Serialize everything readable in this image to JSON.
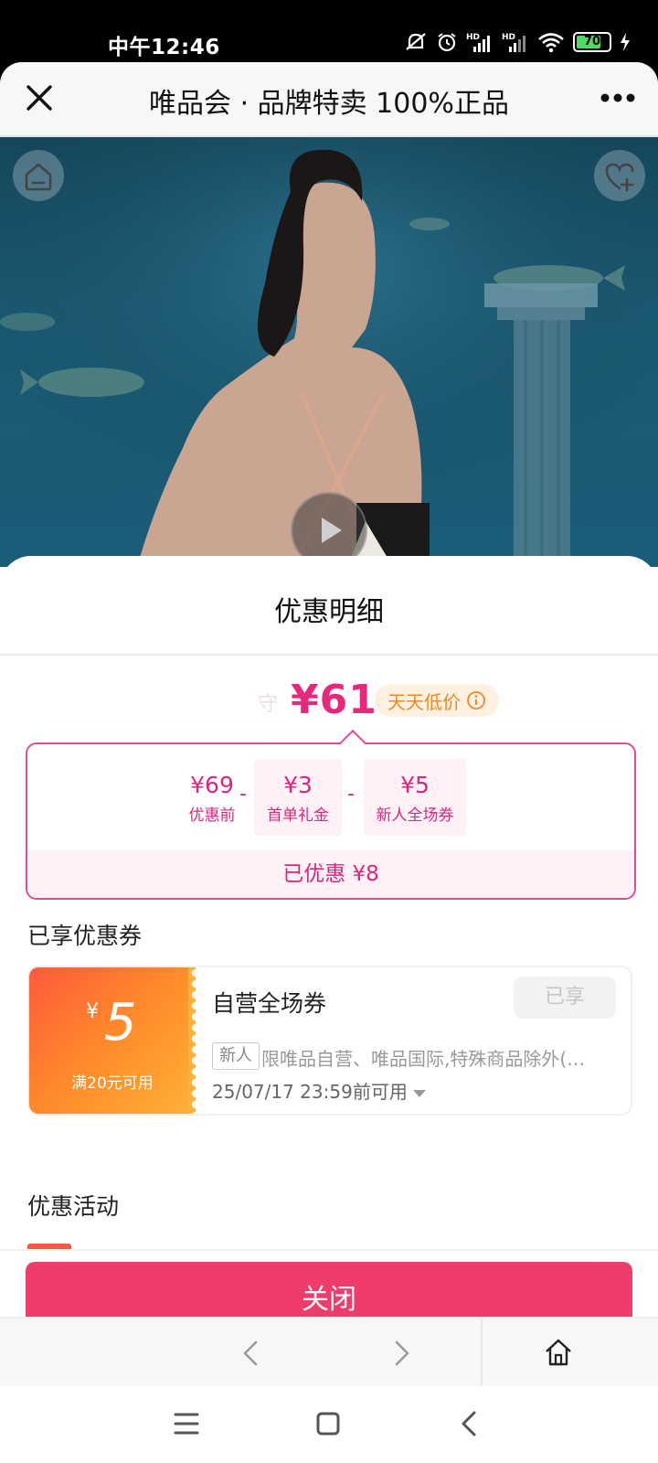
{
  "status_bar": {
    "time": "中午12:46",
    "battery_level": "70",
    "icons": [
      "mute-icon",
      "alarm-icon",
      "hd-signal-icon",
      "hd-signal-icon",
      "wifi-icon",
      "battery-icon",
      "charging-icon"
    ]
  },
  "titlebar": {
    "title": "唯品会 · 品牌特卖 100%正品",
    "close_icon": "close-icon",
    "more_icon": "more-dots-icon"
  },
  "hero": {
    "home_icon": "home-icon",
    "favorite_icon": "heart-plus-icon",
    "play_icon": "play-icon"
  },
  "sheet": {
    "title": "优惠明细",
    "price": {
      "ghost_text": "守",
      "final": "¥61",
      "tag": "天天低价"
    },
    "calculation": [
      {
        "value": "¥69",
        "label": "优惠前"
      },
      {
        "op": "-"
      },
      {
        "value": "¥3",
        "label": "首单礼金"
      },
      {
        "op": "-"
      },
      {
        "value": "¥5",
        "label": "新人全场券"
      }
    ],
    "saved": "已优惠 ¥8",
    "coupons_section_title": "已享优惠券",
    "coupon": {
      "currency": "¥",
      "amount": "5",
      "condition": "满20元可用",
      "name": "自营全场券",
      "status": "已享",
      "tag": "新人",
      "description": "限唯品自营、唯品国际,特殊商品除外(…",
      "expiry": "25/07/17 23:59前可用"
    },
    "activity_section_title": "优惠活动",
    "close_button": "关闭"
  },
  "browser_nav": {
    "back_icon": "chevron-left-icon",
    "forward_icon": "chevron-right-icon",
    "home_icon": "home-outline-icon"
  },
  "system_nav": {
    "menu_icon": "menu-icon",
    "home_icon": "square-icon",
    "back_icon": "back-icon"
  },
  "colors": {
    "accent_pink": "#e8287a",
    "button_pink": "#ef3c6b",
    "tag_orange": "#ee8a24",
    "coupon_gradient_start": "#ff5a3a",
    "coupon_gradient_end": "#ffb238"
  }
}
